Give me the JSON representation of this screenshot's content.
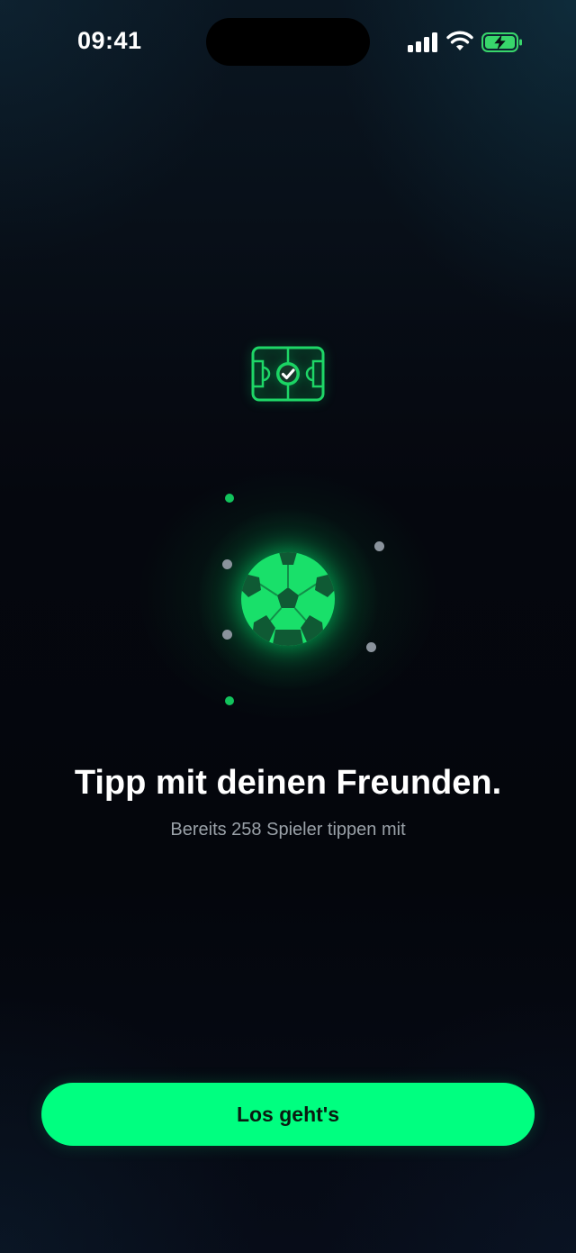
{
  "status_bar": {
    "time": "09:41",
    "icons": [
      "cellular-signal-icon",
      "wifi-icon",
      "battery-charging-icon"
    ]
  },
  "hero": {
    "top_icon": "stadium-check-icon",
    "center_icon": "soccer-ball-icon"
  },
  "headline": "Tipp mit deinen Freunden.",
  "subline": "Bereits 258 Spieler tippen mit",
  "cta": {
    "label": "Los geht's"
  },
  "colors": {
    "accent": "#00ff80",
    "accent_dark": "#12c35c",
    "background": "#05080f",
    "text_primary": "#ffffff",
    "text_secondary": "#9aa1a8"
  }
}
